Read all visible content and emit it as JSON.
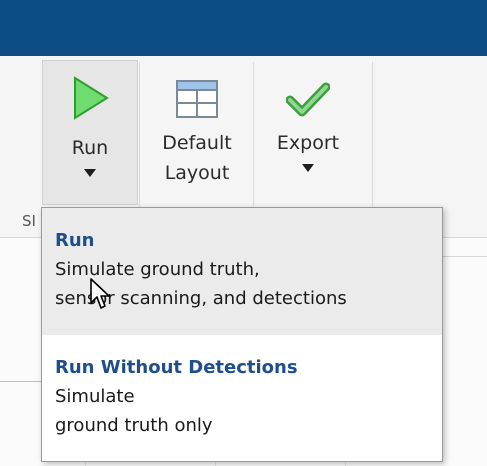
{
  "toolstrip": {
    "run": {
      "label": "Run",
      "icon": "play-icon"
    },
    "layout": {
      "label_line1": "Default",
      "label_line2": "Layout",
      "icon": "layout-grid-icon"
    },
    "export": {
      "label": "Export",
      "icon": "checkmark-icon"
    },
    "section_label": "SI"
  },
  "menu": {
    "items": [
      {
        "title": "Run",
        "desc_line1": "Simulate ground truth,",
        "desc_line2": "sensor scanning, and detections"
      },
      {
        "title": "Run Without Detections",
        "desc_line1": "Simulate",
        "desc_line2": "ground truth only"
      }
    ]
  },
  "colors": {
    "title_bar": "#0d4d86",
    "menu_title": "#1f4e8c",
    "play_icon": "#4cc14c",
    "check_icon": "#5cb85c",
    "hover_bg": "#ebebeb"
  }
}
